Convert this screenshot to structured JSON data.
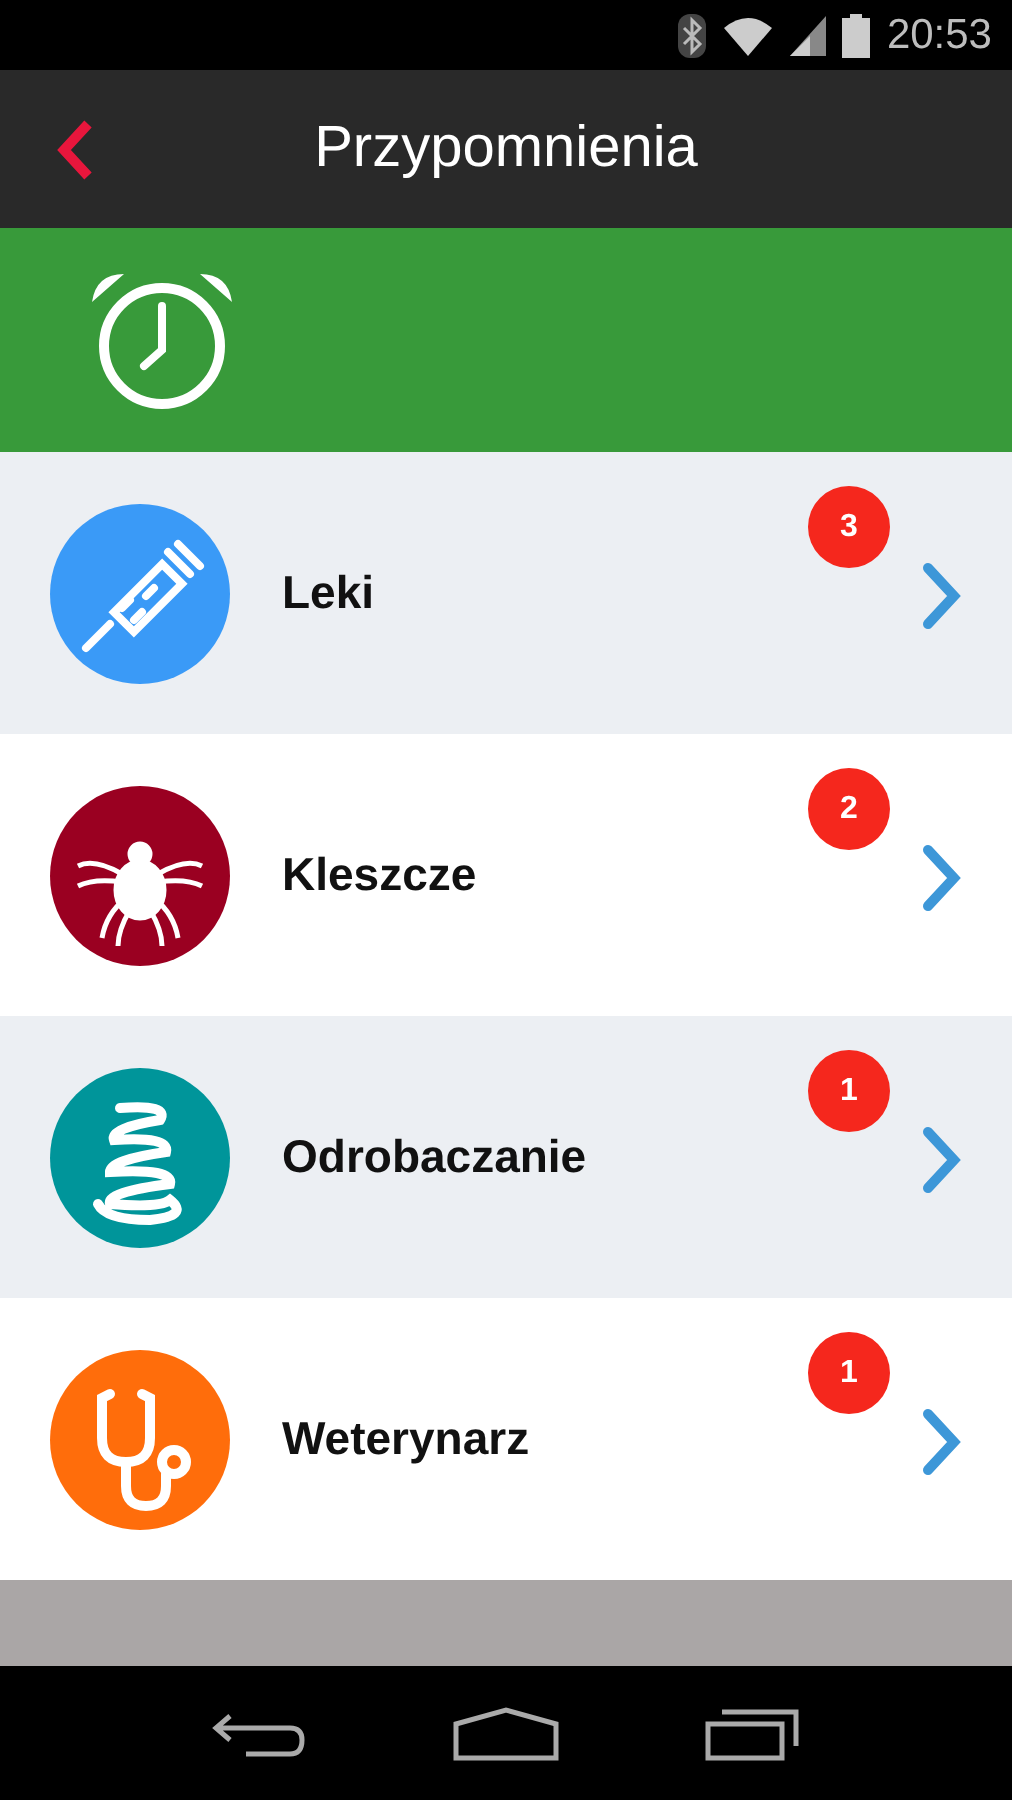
{
  "status_bar": {
    "time": "20:53"
  },
  "toolbar": {
    "title": "Przypomnienia"
  },
  "items": [
    {
      "label": "Leki",
      "badge": "3",
      "kind": "syringe",
      "color": "#3a9af7"
    },
    {
      "label": "Kleszcze",
      "badge": "2",
      "kind": "tick",
      "color": "#9a0021"
    },
    {
      "label": "Odrobaczanie",
      "badge": "1",
      "kind": "worm",
      "color": "#00959a"
    },
    {
      "label": "Weterynarz",
      "badge": "1",
      "kind": "stethoscope",
      "color": "#ff6d0b"
    }
  ]
}
